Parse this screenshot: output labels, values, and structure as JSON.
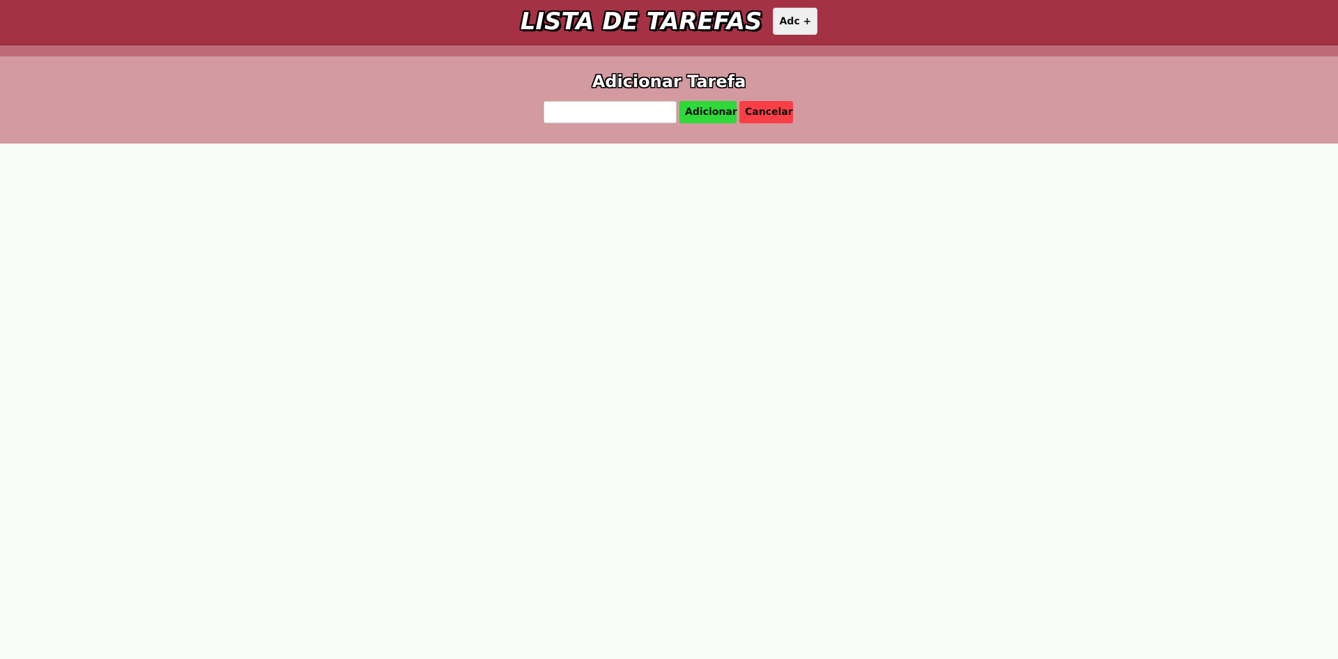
{
  "header": {
    "title": "LISTA DE TAREFAS",
    "add_toggle_label": "Adc +"
  },
  "add_panel": {
    "title": "Adicionar Tarefa",
    "input_value": "",
    "input_placeholder": "",
    "add_label": "Adicionar",
    "cancel_label": "Cancelar"
  },
  "colors": {
    "header_bg": "#a53144",
    "strip_bg": "#bd6a77",
    "panel_bg": "#d39aa0",
    "page_bg": "#fafcf7",
    "add_button": "#2fd93a",
    "cancel_button": "#fb3f46"
  },
  "tasks": []
}
